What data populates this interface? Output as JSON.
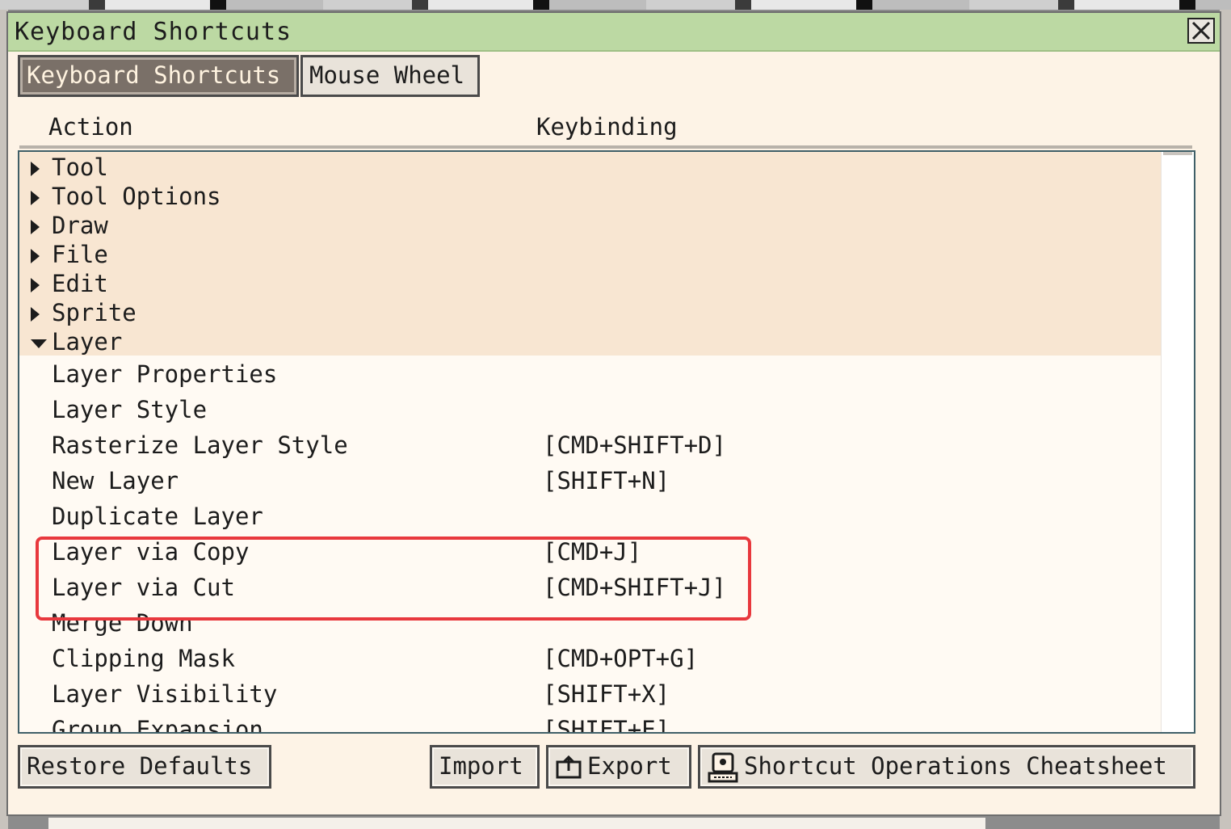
{
  "dialog": {
    "title": "Keyboard Shortcuts"
  },
  "tabs": [
    {
      "label": "Keyboard Shortcuts",
      "active": true
    },
    {
      "label": "Mouse Wheel",
      "active": false
    }
  ],
  "columns": {
    "action": "Action",
    "keybinding": "Keybinding"
  },
  "categories": [
    {
      "label": "Tool",
      "expanded": false
    },
    {
      "label": "Tool Options",
      "expanded": false
    },
    {
      "label": "Draw",
      "expanded": false
    },
    {
      "label": "File",
      "expanded": false
    },
    {
      "label": "Edit",
      "expanded": false
    },
    {
      "label": "Sprite",
      "expanded": false
    },
    {
      "label": "Layer",
      "expanded": true
    }
  ],
  "layer_items": [
    {
      "action": "Layer Properties",
      "key": ""
    },
    {
      "action": "Layer Style",
      "key": ""
    },
    {
      "action": "Rasterize Layer Style",
      "key": "[CMD+SHIFT+D]"
    },
    {
      "action": "New Layer",
      "key": "[SHIFT+N]"
    },
    {
      "action": "Duplicate Layer",
      "key": ""
    },
    {
      "action": "Layer via Copy",
      "key": "[CMD+J]"
    },
    {
      "action": "Layer via Cut",
      "key": "[CMD+SHIFT+J]"
    },
    {
      "action": "Merge Down",
      "key": ""
    },
    {
      "action": "Clipping Mask",
      "key": "[CMD+OPT+G]"
    },
    {
      "action": "Layer Visibility",
      "key": "[SHIFT+X]"
    },
    {
      "action": "Group Expansion",
      "key": "[SHIFT+E]"
    }
  ],
  "footer": {
    "restore": "Restore Defaults",
    "import": "Import",
    "export": "Export",
    "cheatsheet": "Shortcut Operations Cheatsheet"
  },
  "colors": {
    "titlebar": "#bcd9a3",
    "highlight": "#e8383d",
    "active_tab": "#7a7068"
  },
  "icons": {
    "close": "close-icon",
    "export": "export-icon",
    "cheatsheet": "keyboard-person-icon"
  }
}
